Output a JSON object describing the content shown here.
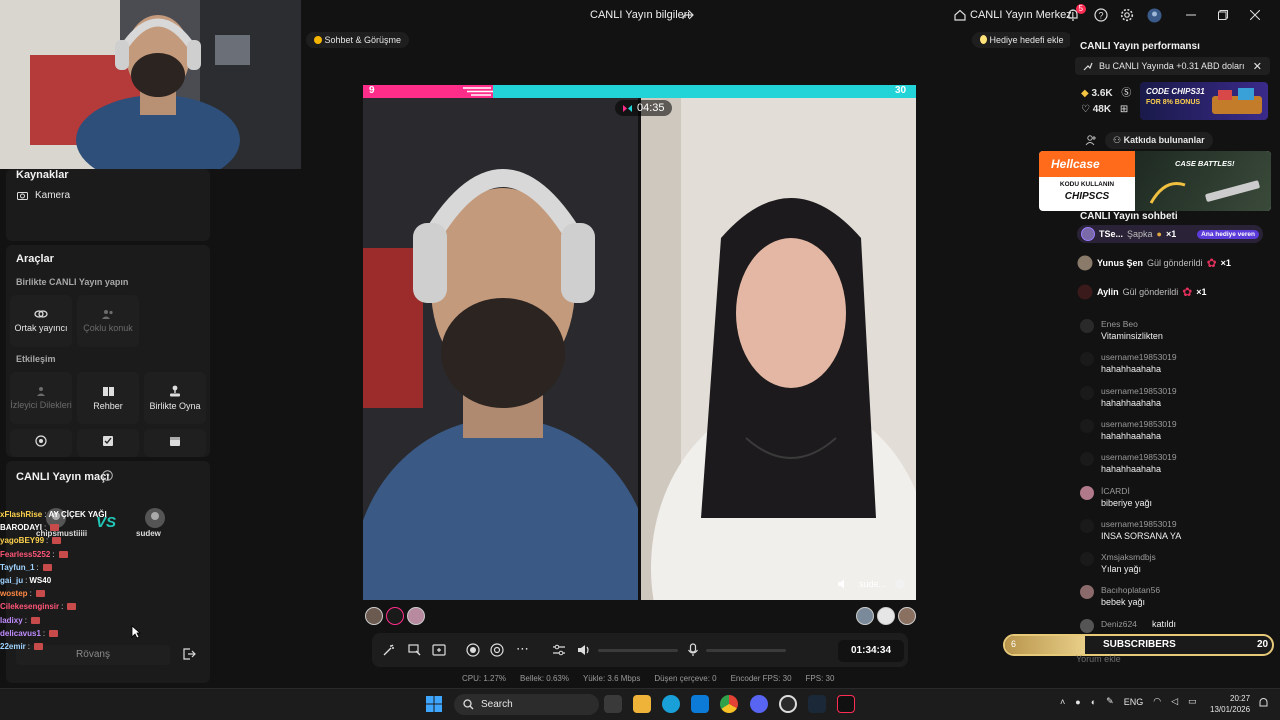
{
  "titlebar": {
    "title": "CANLI Yayın bilgileri",
    "live_center": "CANLI Yayın Merkezi",
    "notification_count": "5"
  },
  "topic_pill": "Sohbet & Görüşme",
  "goal_pill": "Hediye hedefi ekle",
  "left_panel": {
    "sources_title": "Kaynaklar",
    "camera_label": "Kamera",
    "tools_title": "Araçlar",
    "collab_subtitle": "Birlikte CANLI Yayın yapın",
    "cohost_label": "Ortak yayıncı",
    "multiguest_label": "Çoklu konuk",
    "interaction_subtitle": "Etkileşim",
    "viewer_requests_label": "İzleyici Dilekleri",
    "guide_label": "Rehber",
    "play_together_label": "Birlikte Oyna",
    "match_title": "CANLI Yayın maçı",
    "rematch_label": "Rövanş",
    "vs_left_user": "chipsmustiiiii",
    "vs_right_user": "sudew"
  },
  "overlay_chat": [
    {
      "user": "xFlashRise",
      "msg": "AY ÇİÇEK YAĞI",
      "color": "#ffd34d"
    },
    {
      "user": "BARODAYI",
      "msg": "",
      "color": "#ffffff"
    },
    {
      "user": "yagoBEY99",
      "msg": "",
      "color": "#ffd34d"
    },
    {
      "user": "Fearless5252",
      "msg": "",
      "color": "#ff5577"
    },
    {
      "user": "Tayfun_1",
      "msg": "",
      "color": "#9fd3ff"
    },
    {
      "user": "gai_ju",
      "msg": "WS40",
      "color": "#9fd3ff"
    },
    {
      "user": "wostep",
      "msg": "",
      "color": "#ff8844"
    },
    {
      "user": "Cilekesenginsir",
      "msg": "",
      "color": "#ff5577"
    },
    {
      "user": "ladixy",
      "msg": "",
      "color": "#c08cff"
    },
    {
      "user": "delicavus1",
      "msg": "",
      "color": "#c08cff"
    },
    {
      "user": "22emir",
      "msg": "",
      "color": "#9fd3ff"
    }
  ],
  "battle": {
    "left_score": "9",
    "right_score": "30",
    "timer": "04:35",
    "right_name": "sude..."
  },
  "controls": {
    "elapsed": "01:34:34"
  },
  "stats": {
    "cpu": "CPU: 1.27%",
    "memory": "Bellek: 0.63%",
    "upload": "Yükle: 3.6 Mbps",
    "dropped": "Düşen çerçeve: 0",
    "encoder": "Encoder FPS: 30",
    "fps": "FPS: 30"
  },
  "right_panel": {
    "perf_title": "CANLI Yayın performansı",
    "perf_banner": "Bu CANLI Yayında +0.31 ABD doları",
    "diamonds": "3.6K",
    "likes": "48K",
    "contributors": "Katkıda bulunanlar",
    "chat_title": "CANLI Yayın sohbeti",
    "chips_ad_code": "CODE CHIPS31",
    "chips_ad_bonus": "FOR 8% BONUS",
    "hellcase_brand": "Hellcase",
    "hellcase_line1": "KODU KULLANIN",
    "hellcase_code": "CHIPSCS",
    "hellcase_battles": "CASE BATTLES!",
    "gifts": [
      {
        "name": "TSe...",
        "action": "Şapka",
        "count": "×1",
        "tag": "Ana hediye veren"
      },
      {
        "name": "Yunus Şen",
        "action": "Gül gönderildi",
        "count": "×1",
        "tag": ""
      },
      {
        "name": "Aylin",
        "action": "Gül gönderildi",
        "count": "×1",
        "tag": ""
      }
    ],
    "chat": [
      {
        "user": "Enes Beo",
        "msg": "Vitaminsizlikten"
      },
      {
        "user": "username19853019",
        "msg": "hahahhaahaha"
      },
      {
        "user": "username19853019",
        "msg": "hahahhaahaha"
      },
      {
        "user": "username19853019",
        "msg": "hahahhaahaha"
      },
      {
        "user": "username19853019",
        "msg": "hahahhaahaha"
      },
      {
        "user": "İCARDİ",
        "msg": "biberiye yağı"
      },
      {
        "user": "username19853019",
        "msg": "INSA SORSANA YA"
      },
      {
        "user": "Xmsjaksmdbjs",
        "msg": "Yılan yağı"
      },
      {
        "user": "Bacıhoplatan56",
        "msg": "bebek yağı"
      },
      {
        "user": "Deniz624",
        "msg": "katıldı"
      }
    ],
    "subs_current": "6",
    "subs_label": "SUBSCRIBERS",
    "subs_goal": "20",
    "subs_progress": 0.3,
    "comment_placeholder": "Yorum ekle"
  },
  "taskbar": {
    "search_label": "Search",
    "lang": "ENG",
    "time": "20:27",
    "date": "13/01/2026"
  }
}
